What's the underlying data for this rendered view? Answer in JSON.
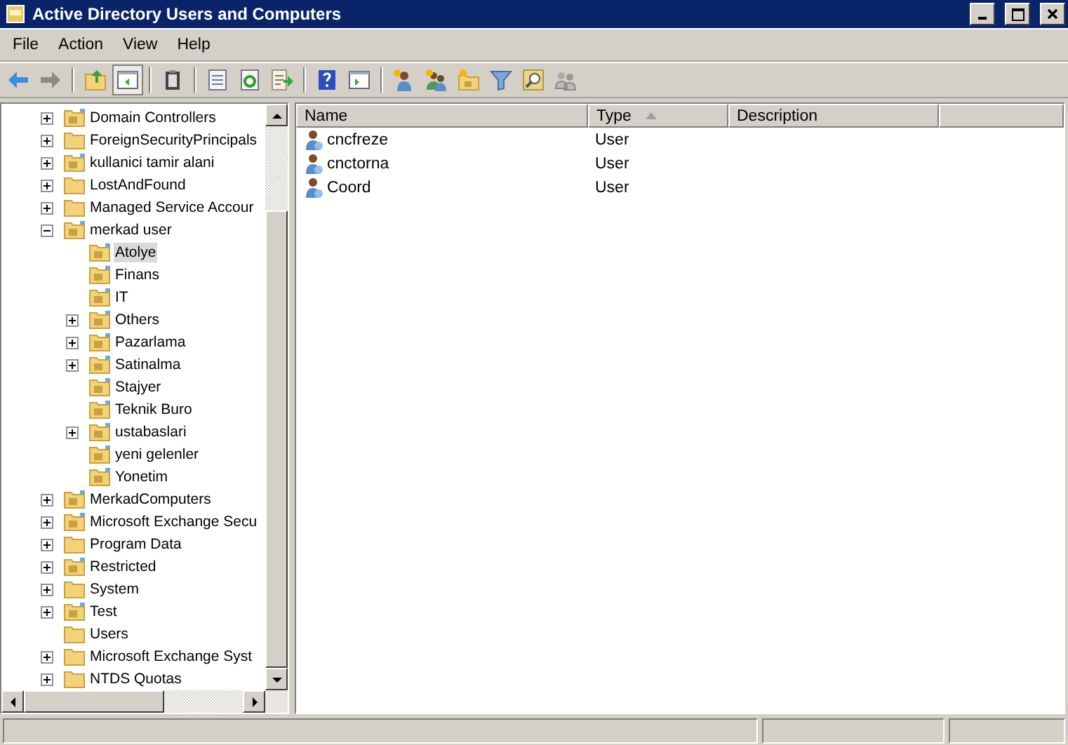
{
  "window": {
    "title": "Active Directory Users and Computers"
  },
  "menu": [
    {
      "label": "File"
    },
    {
      "label": "Action"
    },
    {
      "label": "View"
    },
    {
      "label": "Help"
    }
  ],
  "toolbar": [
    {
      "kind": "back",
      "pressed": false
    },
    {
      "kind": "forward",
      "pressed": false
    },
    {
      "kind": "separator"
    },
    {
      "kind": "up",
      "pressed": false
    },
    {
      "kind": "tree",
      "pressed": true
    },
    {
      "kind": "separator"
    },
    {
      "kind": "clipboard",
      "pressed": false
    },
    {
      "kind": "separator"
    },
    {
      "kind": "properties",
      "pressed": false
    },
    {
      "kind": "refresh",
      "pressed": false
    },
    {
      "kind": "export",
      "pressed": false
    },
    {
      "kind": "separator"
    },
    {
      "kind": "help",
      "pressed": false
    },
    {
      "kind": "actionpane",
      "pressed": false
    },
    {
      "kind": "separator"
    },
    {
      "kind": "newuser",
      "pressed": false
    },
    {
      "kind": "newgroup",
      "pressed": false
    },
    {
      "kind": "newou",
      "pressed": false
    },
    {
      "kind": "filter",
      "pressed": false
    },
    {
      "kind": "find",
      "pressed": false
    },
    {
      "kind": "members",
      "pressed": false
    }
  ],
  "tree": [
    {
      "label": "Domain Controllers",
      "kind": "ou",
      "expandable": true,
      "expanded": false,
      "selected": false
    },
    {
      "label": "ForeignSecurityPrincipals",
      "kind": "container",
      "expandable": true,
      "expanded": false,
      "selected": false
    },
    {
      "label": "kullanici tamir alani",
      "kind": "ou",
      "expandable": true,
      "expanded": false,
      "selected": false
    },
    {
      "label": "LostAndFound",
      "kind": "container",
      "expandable": true,
      "expanded": false,
      "selected": false
    },
    {
      "label": "Managed Service Accour",
      "kind": "container",
      "expandable": true,
      "expanded": false,
      "selected": false
    },
    {
      "label": "merkad user",
      "kind": "ou",
      "expandable": true,
      "expanded": true,
      "selected": false,
      "children": [
        {
          "label": "Atolye",
          "kind": "ou",
          "expandable": false,
          "selected": true
        },
        {
          "label": "Finans",
          "kind": "ou",
          "expandable": false,
          "selected": false
        },
        {
          "label": "IT",
          "kind": "ou",
          "expandable": false,
          "selected": false
        },
        {
          "label": "Others",
          "kind": "ou",
          "expandable": true,
          "expanded": false,
          "selected": false
        },
        {
          "label": "Pazarlama",
          "kind": "ou",
          "expandable": true,
          "expanded": false,
          "selected": false
        },
        {
          "label": "Satinalma",
          "kind": "ou",
          "expandable": true,
          "expanded": false,
          "selected": false
        },
        {
          "label": "Stajyer",
          "kind": "ou",
          "expandable": false,
          "selected": false
        },
        {
          "label": "Teknik Buro",
          "kind": "ou",
          "expandable": false,
          "selected": false
        },
        {
          "label": "ustabaslari",
          "kind": "ou",
          "expandable": true,
          "expanded": false,
          "selected": false
        },
        {
          "label": "yeni gelenler",
          "kind": "ou",
          "expandable": false,
          "selected": false
        },
        {
          "label": "Yonetim",
          "kind": "ou",
          "expandable": false,
          "selected": false
        }
      ]
    },
    {
      "label": "MerkadComputers",
      "kind": "ou",
      "expandable": true,
      "expanded": false,
      "selected": false
    },
    {
      "label": "Microsoft Exchange Secu",
      "kind": "ou",
      "expandable": true,
      "expanded": false,
      "selected": false
    },
    {
      "label": "Program Data",
      "kind": "container",
      "expandable": true,
      "expanded": false,
      "selected": false
    },
    {
      "label": "Restricted",
      "kind": "ou",
      "expandable": true,
      "expanded": false,
      "selected": false
    },
    {
      "label": "System",
      "kind": "container",
      "expandable": true,
      "expanded": false,
      "selected": false
    },
    {
      "label": "Test",
      "kind": "ou",
      "expandable": true,
      "expanded": false,
      "selected": false
    },
    {
      "label": "Users",
      "kind": "container",
      "expandable": false,
      "selected": false
    },
    {
      "label": "Microsoft Exchange Syst",
      "kind": "container",
      "expandable": true,
      "expanded": false,
      "selected": false
    },
    {
      "label": "NTDS Quotas",
      "kind": "container",
      "expandable": true,
      "expanded": false,
      "selected": false
    }
  ],
  "list": {
    "columns": [
      {
        "label": "Name",
        "sorted": false
      },
      {
        "label": "Type",
        "sorted": true
      },
      {
        "label": "Description",
        "sorted": false
      }
    ],
    "rows": [
      {
        "name": "cncfreze",
        "type": "User",
        "selected": false
      },
      {
        "name": "cnctorna",
        "type": "User",
        "selected": false
      },
      {
        "name": "Coord",
        "type": "User",
        "selected": false
      }
    ]
  }
}
